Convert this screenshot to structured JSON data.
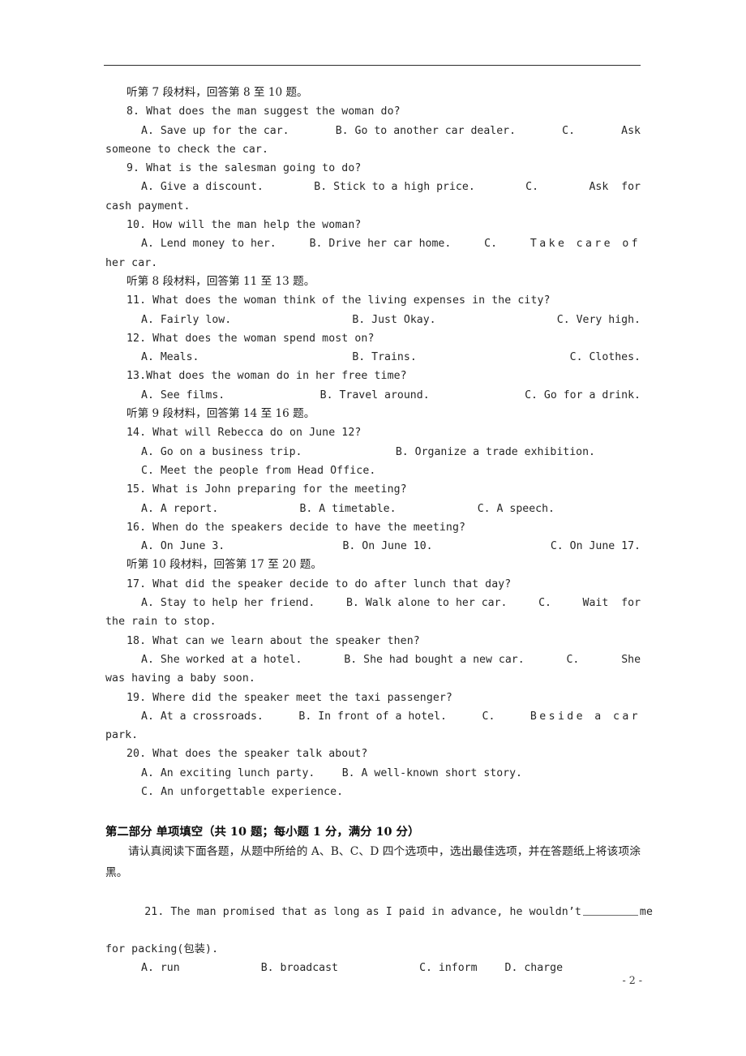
{
  "document": {
    "page_number": "- 2 -"
  },
  "listening": {
    "material_7": "听第 7 段材料，回答第 8 至 10 题。",
    "material_8": "听第 8 段材料，回答第 11 至 13 题。",
    "material_9": "听第 9 段材料，回答第 14 至 16 题。",
    "material_10": "听第 10 段材料，回答第 17 至 20 题。",
    "questions": [
      {
        "number": "8.",
        "stem": "8. What does the man suggest the woman do?",
        "opt_a": "A. Save up for the car.",
        "opt_b": "B. Go to another car dealer.",
        "opt_c_head": "C.",
        "opt_c_tail": "Ask",
        "opt_c_wrap": "someone to check the car."
      },
      {
        "number": "9.",
        "stem": "9. What is the salesman going to do?",
        "opt_a": "A. Give a discount.",
        "opt_b": "B. Stick to a high price.",
        "opt_c_head": "C.",
        "opt_c_tail": "Ask  for",
        "opt_c_wrap": "cash payment."
      },
      {
        "number": "10.",
        "stem": "10. How will the man help the woman?",
        "opt_a": "A. Lend money to her.",
        "opt_b": "B. Drive her car home.",
        "opt_c_head": "C.",
        "opt_c_tail": "Take care of",
        "opt_c_wrap": "her car."
      },
      {
        "number": "11.",
        "stem": "11. What does the woman think of the living expenses in the city?",
        "opt_a": "A. Fairly low.",
        "opt_b": "B. Just Okay.",
        "opt_c": "C. Very high."
      },
      {
        "number": "12.",
        "stem": "12. What does the woman spend most on?",
        "opt_a": "A. Meals.",
        "opt_b": "B. Trains.",
        "opt_c": "C. Clothes."
      },
      {
        "number": "13.",
        "stem": "13.What does the woman do in her free time?",
        "opt_a": "A. See films.",
        "opt_b": "B. Travel around.",
        "opt_c": "C. Go for a drink."
      },
      {
        "number": "14.",
        "stem": "14. What will Rebecca do on June 12?",
        "opt_a": "A. Go on a business trip.",
        "opt_b": "B. Organize a trade exhibition.",
        "opt_c": "C. Meet the people from Head Office."
      },
      {
        "number": "15.",
        "stem": "15. What is John preparing for the meeting?",
        "opt_a": "A. A report.",
        "opt_b": "B. A timetable.",
        "opt_c": "C. A speech."
      },
      {
        "number": "16.",
        "stem": "16. When do the speakers decide to have the meeting?",
        "opt_a": "A. On June 3.",
        "opt_b": "B. On June 10.",
        "opt_c": "C. On June 17."
      },
      {
        "number": "17.",
        "stem": "17. What did the speaker decide to do after lunch that day?",
        "opt_a": "A. Stay to help her friend.",
        "opt_b": "B. Walk alone to her car.",
        "opt_c_head": "C.",
        "opt_c_tail": "Wait  for",
        "opt_c_wrap": "the rain to stop."
      },
      {
        "number": "18.",
        "stem": "18. What can we learn about the speaker then?",
        "opt_a": "A. She worked at a hotel.",
        "opt_b": "B. She had bought a new car.",
        "opt_c_head": "C.",
        "opt_c_tail": "She",
        "opt_c_wrap": "was having a baby soon."
      },
      {
        "number": "19.",
        "stem": "19. Where did the speaker meet the taxi passenger?",
        "opt_a": "A. At a crossroads.",
        "opt_b": "B. In front of a hotel.",
        "opt_c_head": "C.",
        "opt_c_tail": "Beside a car",
        "opt_c_wrap": "park."
      },
      {
        "number": "20.",
        "stem": "20. What does the speaker talk about?",
        "opt_a": "A. An exciting lunch party.",
        "opt_b": "B. A well-known short story.",
        "opt_c": "C. An unforgettable experience."
      }
    ]
  },
  "part_two": {
    "heading": "第二部分 单项填空（共 10 题；每小题 1 分，满分 10 分）",
    "instruction": "请认真阅读下面各题，从题中所给的 A、B、C、D 四个选项中，选出最佳选项，并在答题纸上将该项涂黑。",
    "question_21": {
      "stem_before_blank": "21. The man promised that as long as I paid in advance, he wouldn’t",
      "stem_after_blank": "me",
      "stem_wrap": "for packing(包装).",
      "opt_a": "A. run",
      "opt_b": "B. broadcast",
      "opt_c": "C. inform",
      "opt_d": "D. charge"
    }
  }
}
